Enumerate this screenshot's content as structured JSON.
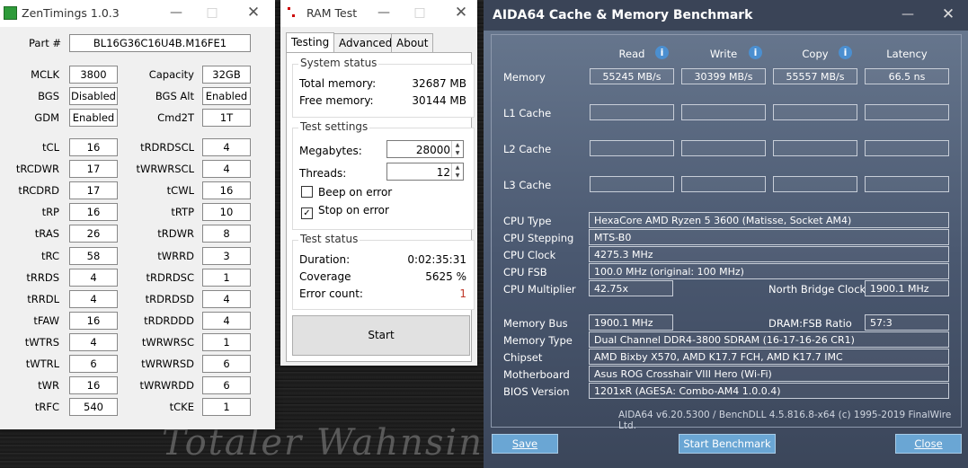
{
  "zen": {
    "title": "ZenTimings 1.0.3",
    "part_label": "Part #",
    "part_value": "BL16G36C16U4B.M16FE1",
    "top_left": [
      {
        "label": "MCLK",
        "value": "3800"
      },
      {
        "label": "BGS",
        "value": "Disabled"
      },
      {
        "label": "GDM",
        "value": "Enabled"
      }
    ],
    "top_right": [
      {
        "label": "Capacity",
        "value": "32GB"
      },
      {
        "label": "BGS Alt",
        "value": "Enabled"
      },
      {
        "label": "Cmd2T",
        "value": "1T"
      }
    ],
    "timings_left": [
      {
        "label": "tCL",
        "value": "16"
      },
      {
        "label": "tRCDWR",
        "value": "17"
      },
      {
        "label": "tRCDRD",
        "value": "17"
      },
      {
        "label": "tRP",
        "value": "16"
      },
      {
        "label": "tRAS",
        "value": "26"
      },
      {
        "label": "tRC",
        "value": "58"
      },
      {
        "label": "tRRDS",
        "value": "4"
      },
      {
        "label": "tRRDL",
        "value": "4"
      },
      {
        "label": "tFAW",
        "value": "16"
      },
      {
        "label": "tWTRS",
        "value": "4"
      },
      {
        "label": "tWTRL",
        "value": "6"
      },
      {
        "label": "tWR",
        "value": "16"
      },
      {
        "label": "tRFC",
        "value": "540"
      }
    ],
    "timings_right": [
      {
        "label": "tRDRDSCL",
        "value": "4"
      },
      {
        "label": "tWRWRSCL",
        "value": "4"
      },
      {
        "label": "tCWL",
        "value": "16"
      },
      {
        "label": "tRTP",
        "value": "10"
      },
      {
        "label": "tRDWR",
        "value": "8"
      },
      {
        "label": "tWRRD",
        "value": "3"
      },
      {
        "label": "tRDRDSC",
        "value": "1"
      },
      {
        "label": "tRDRDSD",
        "value": "4"
      },
      {
        "label": "tRDRDDD",
        "value": "4"
      },
      {
        "label": "tWRWRSC",
        "value": "1"
      },
      {
        "label": "tWRWRSD",
        "value": "6"
      },
      {
        "label": "tWRWRDD",
        "value": "6"
      },
      {
        "label": "tCKE",
        "value": "1"
      }
    ]
  },
  "ram": {
    "title": "RAM Test",
    "tabs": [
      "Testing",
      "Advanced",
      "About"
    ],
    "system_status": {
      "title": "System status",
      "total_label": "Total memory:",
      "total_value": "32687 MB",
      "free_label": "Free memory:",
      "free_value": "30144 MB"
    },
    "test_settings": {
      "title": "Test settings",
      "megabytes_label": "Megabytes:",
      "megabytes_value": "28000",
      "threads_label": "Threads:",
      "threads_value": "12",
      "beep_label": "Beep on error",
      "stop_label": "Stop on error"
    },
    "test_status": {
      "title": "Test status",
      "duration_label": "Duration:",
      "duration_value": "0:02:35:31",
      "coverage_label": "Coverage",
      "coverage_value": "5625 %",
      "errors_label": "Error count:",
      "errors_value": "1"
    },
    "start_label": "Start"
  },
  "aida": {
    "title": "AIDA64 Cache & Memory Benchmark",
    "headers": [
      "Read",
      "Write",
      "Copy",
      "Latency"
    ],
    "rows": [
      {
        "label": "Memory",
        "values": [
          "55245 MB/s",
          "30399 MB/s",
          "55557 MB/s",
          "66.5 ns"
        ]
      },
      {
        "label": "L1 Cache",
        "values": [
          "",
          "",
          "",
          ""
        ]
      },
      {
        "label": "L2 Cache",
        "values": [
          "",
          "",
          "",
          ""
        ]
      },
      {
        "label": "L3 Cache",
        "values": [
          "",
          "",
          "",
          ""
        ]
      }
    ],
    "cpu_type_label": "CPU Type",
    "cpu_type": "HexaCore AMD Ryzen 5 3600  (Matisse, Socket AM4)",
    "cpu_stepping_label": "CPU Stepping",
    "cpu_stepping": "MTS-B0",
    "cpu_clock_label": "CPU Clock",
    "cpu_clock": "4275.3 MHz",
    "cpu_fsb_label": "CPU FSB",
    "cpu_fsb": "100.0 MHz  (original: 100 MHz)",
    "cpu_mult_label": "CPU Multiplier",
    "cpu_mult": "42.75x",
    "nb_clock_label": "North Bridge Clock",
    "nb_clock": "1900.1 MHz",
    "mem_bus_label": "Memory Bus",
    "mem_bus": "1900.1 MHz",
    "dram_fsb_label": "DRAM:FSB Ratio",
    "dram_fsb": "57:3",
    "mem_type_label": "Memory Type",
    "mem_type": "Dual Channel DDR4-3800 SDRAM  (16-17-16-26 CR1)",
    "chipset_label": "Chipset",
    "chipset": "AMD Bixby X570, AMD K17.7 FCH, AMD K17.7 IMC",
    "mobo_label": "Motherboard",
    "mobo": "Asus ROG Crosshair VIII Hero (Wi-Fi)",
    "bios_label": "BIOS Version",
    "bios": "1201xR  (AGESA: Combo-AM4 1.0.0.4)",
    "footer": "AIDA64 v6.20.5300 / BenchDLL 4.5.816.8-x64  (c) 1995-2019 FinalWire Ltd.",
    "save_label": "Save",
    "start_label": "Start Benchmark",
    "close_label": "Close"
  },
  "watermark": "Totaler Wahnsinn"
}
